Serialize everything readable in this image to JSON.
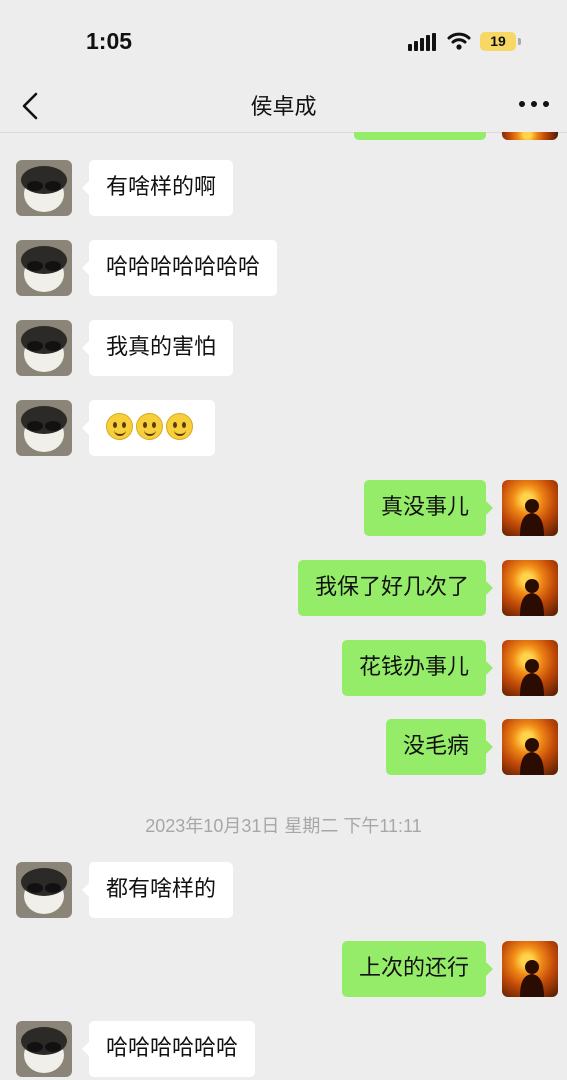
{
  "status": {
    "time": "1:05",
    "battery": "19"
  },
  "header": {
    "title": "侯卓成"
  },
  "messages": [
    {
      "text": "有啥样的啊"
    },
    {
      "text": "哈哈哈哈哈哈哈"
    },
    {
      "text": "我真的害怕"
    },
    {
      "text": "",
      "emoji": [
        "smile-emoji",
        "smile-emoji",
        "smile-emoji"
      ]
    },
    {
      "text": "真没事儿"
    },
    {
      "text": "我保了好几次了"
    },
    {
      "text": "花钱办事儿"
    },
    {
      "text": "没毛病"
    },
    {
      "text": "都有啥样的"
    },
    {
      "text": "上次的还行"
    },
    {
      "text": "哈哈哈哈哈哈"
    }
  ],
  "timestamp": "2023年10月31日 星期二 下午11:11",
  "colors": {
    "outgoing_bubble": "#95ec69",
    "incoming_bubble": "#ffffff",
    "background": "#ededed"
  }
}
